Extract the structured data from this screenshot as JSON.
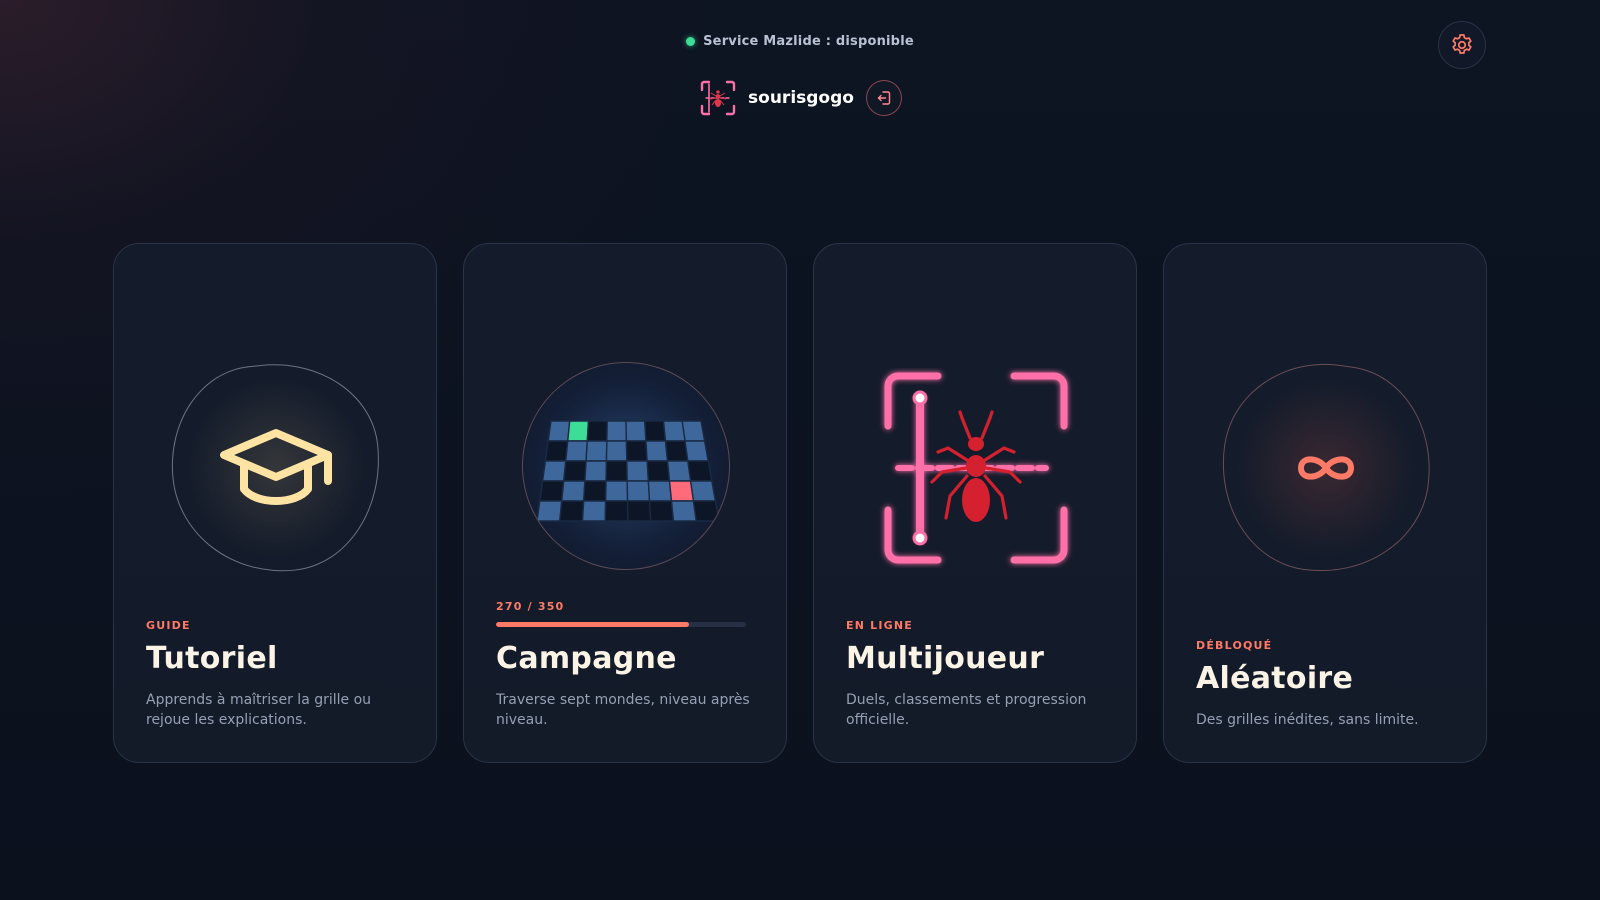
{
  "status": {
    "text": "Service Mazlide : disponible",
    "color": "#3ddc97"
  },
  "user": {
    "name": "sourisgogo",
    "avatar_icon": "ant-target-icon",
    "logout_icon": "logout-icon"
  },
  "settings": {
    "icon": "gear-icon"
  },
  "theme": {
    "accent": "#ff7a66",
    "pink": "#ff6fa8",
    "background": "#0c111d",
    "card": "#141c2c"
  },
  "cards": [
    {
      "kicker": "GUIDE",
      "title": "Tutoriel",
      "description": "Apprends à maîtriser la grille ou rejoue les explications.",
      "icon": "graduation-cap-icon"
    },
    {
      "progress_label": "270 / 350",
      "progress": 0.7714,
      "title": "Campagne",
      "description": "Traverse sept mondes, niveau après niveau.",
      "icon": "grid-board-icon"
    },
    {
      "kicker": "EN LIGNE",
      "title": "Multijoueur",
      "description": "Duels, classements et progression officielle.",
      "icon": "ant-target-icon"
    },
    {
      "kicker": "DÉBLOQUÉ",
      "title": "Aléatoire",
      "description": "Des grilles inédites, sans limite.",
      "icon": "infinity-icon"
    }
  ]
}
